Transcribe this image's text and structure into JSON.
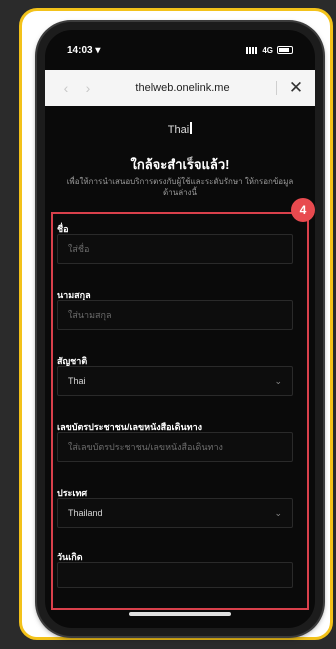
{
  "status_bar": {
    "time": "14:03 ▾",
    "network": "4G"
  },
  "browser": {
    "back": "‹",
    "forward": "›",
    "url": "thelweb.onelink.me",
    "close": "✕"
  },
  "logo_text": "Thai",
  "header": {
    "title": "ใกล้จะสำเร็จแล้ว!",
    "subtitle": "เพื่อให้การนำเสนอบริการตรงกับผู้ใช้และระดับรักษา ให้กรอกข้อมูลด้านล่างนี้"
  },
  "badge": "4",
  "form": {
    "first_name": {
      "label": "ชื่อ",
      "placeholder": "ใส่ชื่อ"
    },
    "last_name": {
      "label": "นามสกุล",
      "placeholder": "ใส่นามสกุล"
    },
    "nationality": {
      "label": "สัญชาติ",
      "value": "Thai"
    },
    "id_number": {
      "label": "เลขบัตรประชาชน/เลขหนังสือเดินทาง",
      "placeholder": "ใส่เลขบัตรประชาชน/เลขหนังสือเดินทาง"
    },
    "country": {
      "label": "ประเทศ",
      "value": "Thailand"
    },
    "birthdate": {
      "label": "วันเกิด"
    }
  }
}
